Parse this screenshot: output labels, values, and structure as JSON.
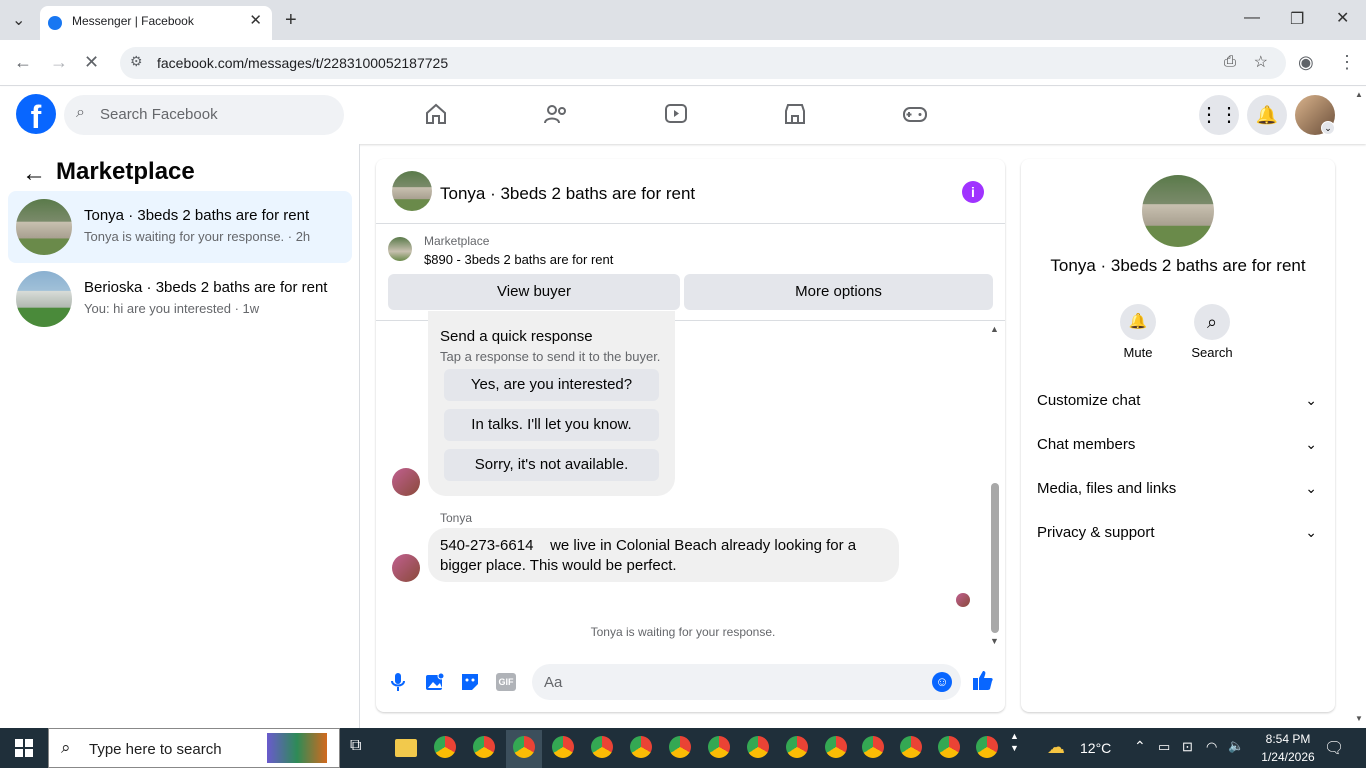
{
  "browser": {
    "tab_title": "Messenger | Facebook",
    "url": "facebook.com/messages/t/2283100052187725"
  },
  "fb": {
    "logo_letter": "f",
    "search_placeholder": "Search Facebook"
  },
  "left": {
    "heading": "Marketplace",
    "conversations": [
      {
        "title": "Tonya · 3beds 2 baths are for rent",
        "snippet": "Tonya is waiting for your response. · 2h"
      },
      {
        "title": "Berioska · 3beds 2 baths are for rent",
        "snippet": "You: hi are you interested · 1w"
      }
    ]
  },
  "chat": {
    "header_title": "Tonya · 3beds 2 baths are for rent",
    "listing_label": "Marketplace",
    "listing_price_title": "$890 - 3beds 2 baths are for rent",
    "view_buyer": "View buyer",
    "more_options": "More options",
    "quick_title": "Send a quick response",
    "quick_sub": "Tap a response to send it to the buyer.",
    "quick_responses": [
      "Yes, are you interested?",
      "In talks. I'll let you know.",
      "Sorry, it's not available."
    ],
    "sender_name": "Tonya",
    "message_line1": "540-273-6614    we live in Colonial Beach already looking for a",
    "message_line2": "bigger place. This would be perfect.",
    "status": "Tonya is waiting for your response.",
    "composer_placeholder": "Aa",
    "gif_label": "GIF"
  },
  "info": {
    "name": "Tonya · 3beds 2 baths are for rent",
    "mute": "Mute",
    "search": "Search",
    "sections": [
      "Customize chat",
      "Chat members",
      "Media, files and links",
      "Privacy & support"
    ]
  },
  "taskbar": {
    "search_placeholder": "Type here to search",
    "temp": "12°C",
    "time": "8:54 PM",
    "date": "1/24/2026"
  },
  "colors": {
    "fb_blue": "#0866ff",
    "messenger_purple": "#a033ff",
    "taskbar": "#1f2f3a"
  }
}
